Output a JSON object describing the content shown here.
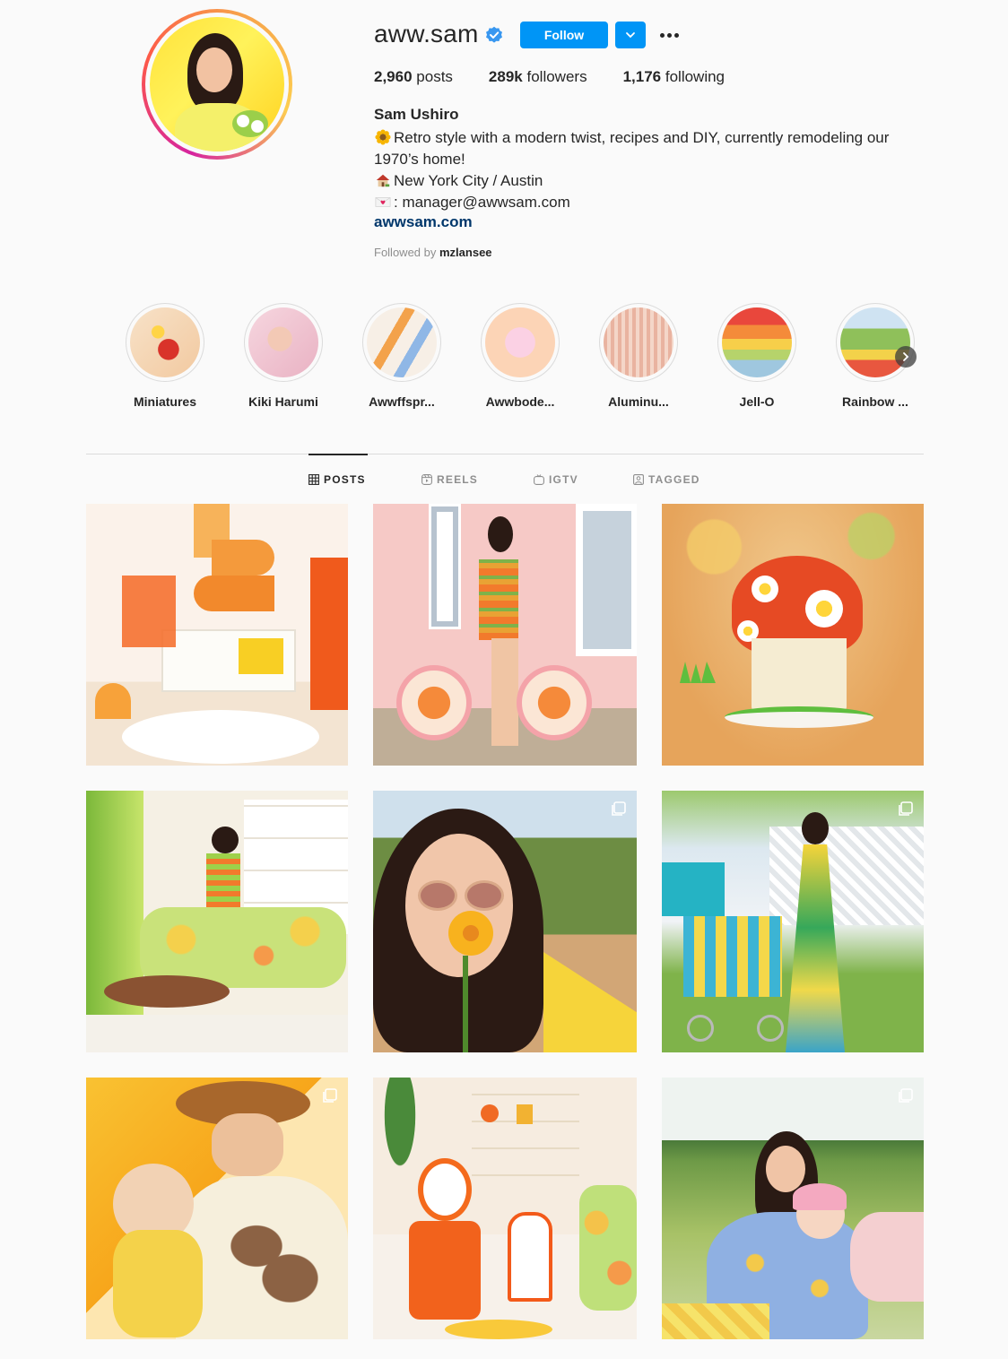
{
  "profile": {
    "username": "aww.sam",
    "verified": true,
    "follow_label": "Follow",
    "stats": {
      "posts_count": "2,960",
      "posts_label": "posts",
      "followers_count": "289k",
      "followers_label": "followers",
      "following_count": "1,176",
      "following_label": "following"
    },
    "full_name": "Sam Ushiro",
    "bio": {
      "line1": "Retro style with a modern twist, recipes and DIY, currently remodeling our 1970’s home!",
      "line2": "New York City / Austin",
      "line3": ": manager@awwsam.com"
    },
    "website": "awwsam.com",
    "followed_by_prefix": "Followed by",
    "followed_by_user": "mzlansee"
  },
  "highlights": [
    {
      "label": "Miniatures"
    },
    {
      "label": "Kiki Harumi"
    },
    {
      "label": "Awwffspr..."
    },
    {
      "label": "Awwbode..."
    },
    {
      "label": "Aluminu..."
    },
    {
      "label": "Jell-O"
    },
    {
      "label": "Rainbow ..."
    }
  ],
  "tabs": {
    "posts": "POSTS",
    "reels": "REELS",
    "igtv": "IGTV",
    "tagged": "TAGGED"
  },
  "colors": {
    "accent": "#0095f6",
    "link": "#00376b",
    "text": "#262626",
    "muted": "#8e8e8e",
    "background": "#fafafa"
  },
  "icons": {
    "verified": "verified-badge-icon",
    "more": "ellipsis-icon",
    "dropdown": "chevron-down-icon",
    "posts_tab": "grid-icon",
    "reels_tab": "reels-icon",
    "igtv_tab": "igtv-icon",
    "tagged_tab": "tagged-icon",
    "multi_post": "carousel-icon"
  }
}
